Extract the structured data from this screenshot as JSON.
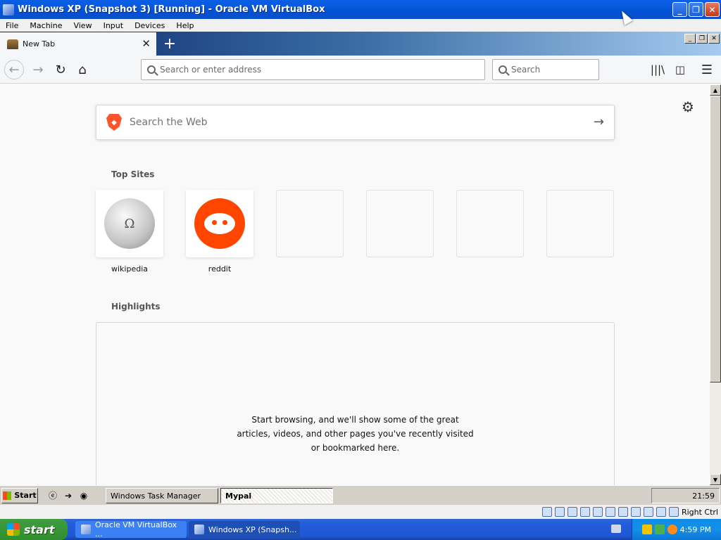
{
  "vbox": {
    "title": "Windows XP (Snapshot 3) [Running] - Oracle VM VirtualBox",
    "menu": [
      "File",
      "Machine",
      "View",
      "Input",
      "Devices",
      "Help"
    ],
    "status_host_key": "Right Ctrl"
  },
  "browser": {
    "tab_title": "New Tab",
    "tab_close": "✕",
    "new_tab": "+",
    "url_placeholder": "Search or enter address",
    "search_placeholder": "Search"
  },
  "newtab": {
    "web_search_placeholder": "Search the Web",
    "top_sites_title": "Top Sites",
    "top_sites": [
      {
        "label": "wikipedia",
        "icon": "wikipedia-globe-icon"
      },
      {
        "label": "reddit",
        "icon": "reddit-alien-icon"
      },
      {
        "label": "",
        "icon": ""
      },
      {
        "label": "",
        "icon": ""
      },
      {
        "label": "",
        "icon": ""
      },
      {
        "label": "",
        "icon": ""
      }
    ],
    "highlights_title": "Highlights",
    "highlights_empty": "Start browsing, and we'll show some of the great articles, videos, and other pages you've recently visited or bookmarked here."
  },
  "guest_taskbar": {
    "start_label": "Start",
    "tasks": [
      "Windows Task Manager",
      "Mypal"
    ],
    "active_task": "Mypal",
    "clock": "21:59"
  },
  "host_taskbar": {
    "start_label": "start",
    "tasks": [
      "Oracle VM VirtualBox ...",
      "Windows XP (Snapsh..."
    ],
    "clock": "4:59 PM"
  },
  "colors": {
    "xp_blue": "#0A5FE6",
    "start_green": "#379737",
    "reddit": "#FF4500",
    "brave": "#FB542B"
  }
}
